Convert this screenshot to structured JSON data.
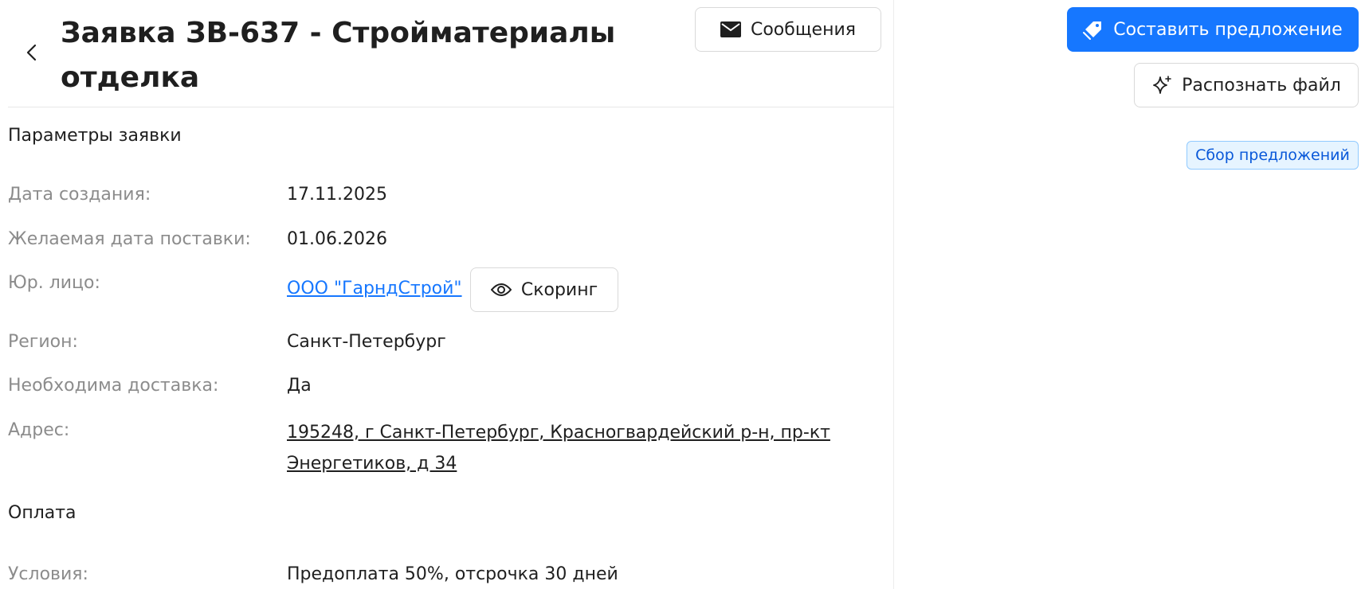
{
  "header": {
    "title": "Заявка ЗВ-637 - Стройматериалы отделка",
    "messages_label": "Сообщения"
  },
  "actions": {
    "make_offer_label": "Составить предложение",
    "recognize_file_label": "Распознать файл"
  },
  "status": {
    "label": "Сбор предложений",
    "color": "#0958d9",
    "background": "#e6f4ff"
  },
  "parameters": {
    "section_title": "Параметры заявки",
    "created": {
      "label": "Дата создания:",
      "value": "17.11.2025"
    },
    "delivery_date": {
      "label": "Желаемая дата поставки:",
      "value": "01.06.2026"
    },
    "legal_entity": {
      "label": "Юр. лицо:",
      "value": "ООО \"ГарндСтрой\"",
      "scoring_label": "Скоринг"
    },
    "region": {
      "label": "Регион:",
      "value": "Санкт-Петербург"
    },
    "delivery_needed": {
      "label": "Необходима доставка:",
      "value": "Да"
    },
    "address": {
      "label": "Адрес:",
      "value": "195248, г Санкт-Петербург, Красногвардейский р-н, пр-кт Энергетиков, д 34"
    }
  },
  "payment": {
    "section_title": "Оплата",
    "terms": {
      "label": "Условия:",
      "value": "Предоплата 50%, отсрочка 30 дней"
    }
  },
  "icons": {
    "back": "chevron-left-icon",
    "messages": "envelope-icon",
    "offer": "tag-icon",
    "recognize": "sparkle-icon",
    "scoring": "eye-icon"
  },
  "colors": {
    "primary": "#1677ff",
    "label": "#8c8c8c",
    "text": "#1f1f1f"
  }
}
